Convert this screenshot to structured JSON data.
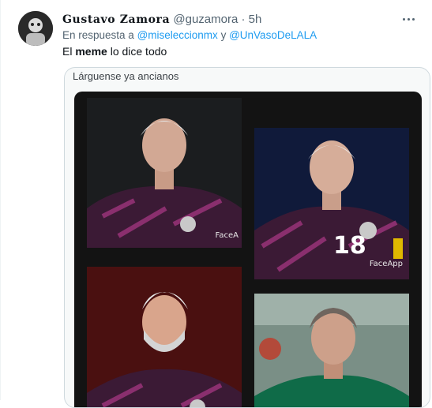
{
  "tweet": {
    "display_name": "Gustavo Zamora",
    "handle": "@guzamora",
    "separator": "·",
    "time": "5h",
    "reply_prefix": "En respuesta a",
    "mention_1": "@miseleccionmx",
    "reply_join": "y",
    "mention_2": "@UnVasoDeLALA",
    "text_before": "El",
    "text_bold": "meme",
    "text_after": "lo dice todo"
  },
  "media": {
    "caption": "Lárguense ya ancianos",
    "photos": [
      {
        "watermark": "FaceA"
      },
      {
        "watermark": "FaceApp",
        "jersey_number": "18"
      },
      {},
      {}
    ]
  },
  "colors": {
    "link": "#1d9bf0",
    "secondary_text": "#536471",
    "jersey": "#3b1a35",
    "jersey_pattern": "#8a2f6e"
  },
  "icons": [
    "more-icon"
  ]
}
